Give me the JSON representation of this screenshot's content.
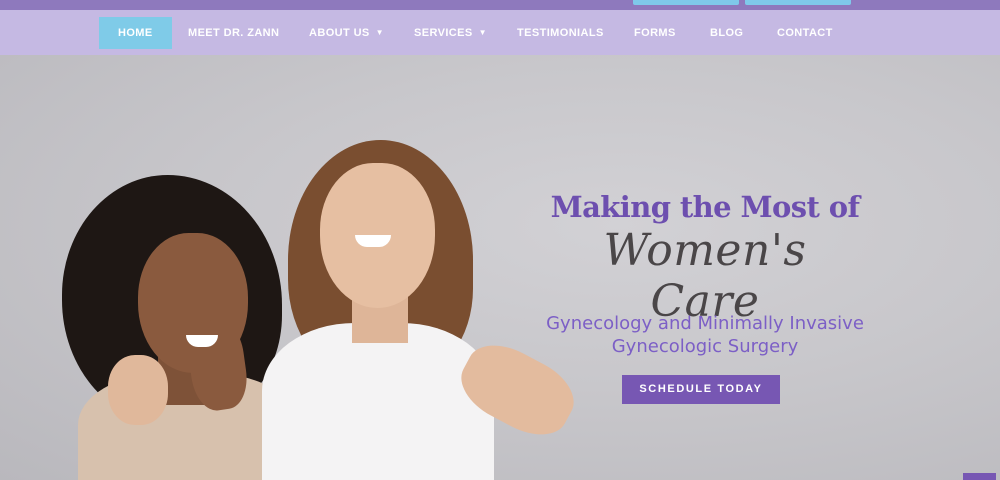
{
  "nav": {
    "items": [
      {
        "label": "HOME",
        "active": true
      },
      {
        "label": "MEET DR. ZANN"
      },
      {
        "label": "ABOUT US",
        "dropdown": true
      },
      {
        "label": "SERVICES",
        "dropdown": true
      },
      {
        "label": "TESTIMONIALS"
      },
      {
        "label": "FORMS"
      },
      {
        "label": "BLOG"
      },
      {
        "label": "CONTACT"
      }
    ]
  },
  "hero": {
    "headline": "Making the Most of",
    "script_title": "Women's Care",
    "subtitle_line1": "Gynecology and Minimally Invasive",
    "subtitle_line2": "Gynecologic Surgery",
    "cta_label": "SCHEDULE TODAY"
  },
  "icons": {
    "dropdown": "chevron-down-icon"
  },
  "colors": {
    "topbar": "#8e79bd",
    "nav_bg": "#c5b9e3",
    "nav_active": "#7fcbe8",
    "headline": "#6d4faf",
    "subtitle": "#7c5fc6",
    "cta_bg": "#7757b3",
    "top_buttons": "#7fc9ea"
  }
}
